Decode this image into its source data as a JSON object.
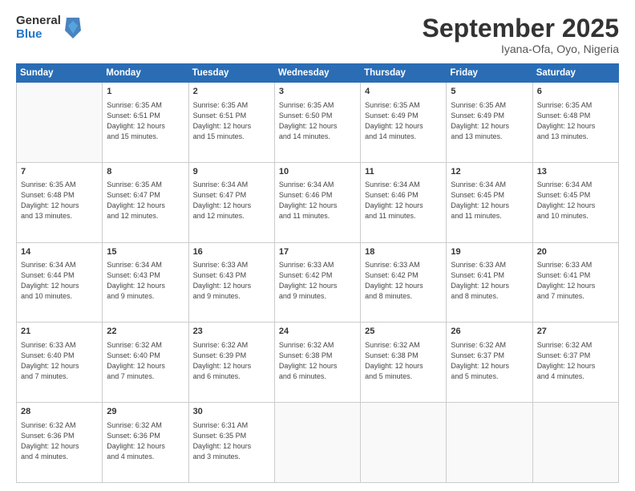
{
  "logo": {
    "general": "General",
    "blue": "Blue"
  },
  "header": {
    "month": "September 2025",
    "location": "Iyana-Ofa, Oyo, Nigeria"
  },
  "days_of_week": [
    "Sunday",
    "Monday",
    "Tuesday",
    "Wednesday",
    "Thursday",
    "Friday",
    "Saturday"
  ],
  "weeks": [
    [
      {
        "num": "",
        "info": ""
      },
      {
        "num": "1",
        "info": "Sunrise: 6:35 AM\nSunset: 6:51 PM\nDaylight: 12 hours\nand 15 minutes."
      },
      {
        "num": "2",
        "info": "Sunrise: 6:35 AM\nSunset: 6:51 PM\nDaylight: 12 hours\nand 15 minutes."
      },
      {
        "num": "3",
        "info": "Sunrise: 6:35 AM\nSunset: 6:50 PM\nDaylight: 12 hours\nand 14 minutes."
      },
      {
        "num": "4",
        "info": "Sunrise: 6:35 AM\nSunset: 6:49 PM\nDaylight: 12 hours\nand 14 minutes."
      },
      {
        "num": "5",
        "info": "Sunrise: 6:35 AM\nSunset: 6:49 PM\nDaylight: 12 hours\nand 13 minutes."
      },
      {
        "num": "6",
        "info": "Sunrise: 6:35 AM\nSunset: 6:48 PM\nDaylight: 12 hours\nand 13 minutes."
      }
    ],
    [
      {
        "num": "7",
        "info": "Sunrise: 6:35 AM\nSunset: 6:48 PM\nDaylight: 12 hours\nand 13 minutes."
      },
      {
        "num": "8",
        "info": "Sunrise: 6:35 AM\nSunset: 6:47 PM\nDaylight: 12 hours\nand 12 minutes."
      },
      {
        "num": "9",
        "info": "Sunrise: 6:34 AM\nSunset: 6:47 PM\nDaylight: 12 hours\nand 12 minutes."
      },
      {
        "num": "10",
        "info": "Sunrise: 6:34 AM\nSunset: 6:46 PM\nDaylight: 12 hours\nand 11 minutes."
      },
      {
        "num": "11",
        "info": "Sunrise: 6:34 AM\nSunset: 6:46 PM\nDaylight: 12 hours\nand 11 minutes."
      },
      {
        "num": "12",
        "info": "Sunrise: 6:34 AM\nSunset: 6:45 PM\nDaylight: 12 hours\nand 11 minutes."
      },
      {
        "num": "13",
        "info": "Sunrise: 6:34 AM\nSunset: 6:45 PM\nDaylight: 12 hours\nand 10 minutes."
      }
    ],
    [
      {
        "num": "14",
        "info": "Sunrise: 6:34 AM\nSunset: 6:44 PM\nDaylight: 12 hours\nand 10 minutes."
      },
      {
        "num": "15",
        "info": "Sunrise: 6:34 AM\nSunset: 6:43 PM\nDaylight: 12 hours\nand 9 minutes."
      },
      {
        "num": "16",
        "info": "Sunrise: 6:33 AM\nSunset: 6:43 PM\nDaylight: 12 hours\nand 9 minutes."
      },
      {
        "num": "17",
        "info": "Sunrise: 6:33 AM\nSunset: 6:42 PM\nDaylight: 12 hours\nand 9 minutes."
      },
      {
        "num": "18",
        "info": "Sunrise: 6:33 AM\nSunset: 6:42 PM\nDaylight: 12 hours\nand 8 minutes."
      },
      {
        "num": "19",
        "info": "Sunrise: 6:33 AM\nSunset: 6:41 PM\nDaylight: 12 hours\nand 8 minutes."
      },
      {
        "num": "20",
        "info": "Sunrise: 6:33 AM\nSunset: 6:41 PM\nDaylight: 12 hours\nand 7 minutes."
      }
    ],
    [
      {
        "num": "21",
        "info": "Sunrise: 6:33 AM\nSunset: 6:40 PM\nDaylight: 12 hours\nand 7 minutes."
      },
      {
        "num": "22",
        "info": "Sunrise: 6:32 AM\nSunset: 6:40 PM\nDaylight: 12 hours\nand 7 minutes."
      },
      {
        "num": "23",
        "info": "Sunrise: 6:32 AM\nSunset: 6:39 PM\nDaylight: 12 hours\nand 6 minutes."
      },
      {
        "num": "24",
        "info": "Sunrise: 6:32 AM\nSunset: 6:38 PM\nDaylight: 12 hours\nand 6 minutes."
      },
      {
        "num": "25",
        "info": "Sunrise: 6:32 AM\nSunset: 6:38 PM\nDaylight: 12 hours\nand 5 minutes."
      },
      {
        "num": "26",
        "info": "Sunrise: 6:32 AM\nSunset: 6:37 PM\nDaylight: 12 hours\nand 5 minutes."
      },
      {
        "num": "27",
        "info": "Sunrise: 6:32 AM\nSunset: 6:37 PM\nDaylight: 12 hours\nand 4 minutes."
      }
    ],
    [
      {
        "num": "28",
        "info": "Sunrise: 6:32 AM\nSunset: 6:36 PM\nDaylight: 12 hours\nand 4 minutes."
      },
      {
        "num": "29",
        "info": "Sunrise: 6:32 AM\nSunset: 6:36 PM\nDaylight: 12 hours\nand 4 minutes."
      },
      {
        "num": "30",
        "info": "Sunrise: 6:31 AM\nSunset: 6:35 PM\nDaylight: 12 hours\nand 3 minutes."
      },
      {
        "num": "",
        "info": ""
      },
      {
        "num": "",
        "info": ""
      },
      {
        "num": "",
        "info": ""
      },
      {
        "num": "",
        "info": ""
      }
    ]
  ]
}
